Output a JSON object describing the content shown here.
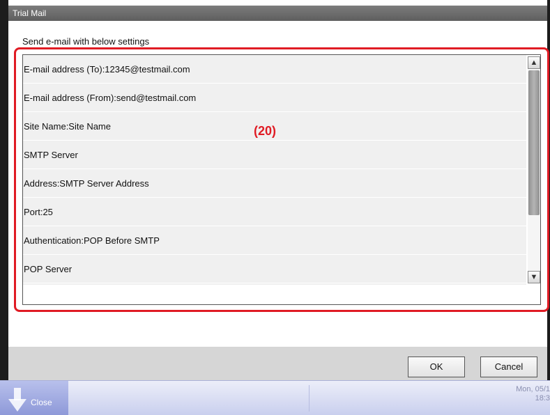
{
  "dialog": {
    "title": "Trial Mail",
    "instruction": "Send e-mail with below settings"
  },
  "settings": {
    "rows": [
      "E-mail address (To):12345@testmail.com",
      "E-mail address (From):send@testmail.com",
      "Site Name:Site Name",
      "SMTP Server",
      "Address:SMTP Server Address",
      "Port:25",
      "Authentication:POP Before SMTP",
      "POP Server"
    ]
  },
  "scroll": {
    "up_glyph": "▲",
    "down_glyph": "▼",
    "position": 0
  },
  "annotation": {
    "label": "(20)",
    "color": "#e01b24"
  },
  "buttons": {
    "ok_label": "OK",
    "cancel_label": "Cancel"
  },
  "taskbar": {
    "close_label": "Close",
    "close_icon": "down-arrow-icon",
    "date_partial": "Mon, 05/1",
    "time_partial": "18:3"
  }
}
